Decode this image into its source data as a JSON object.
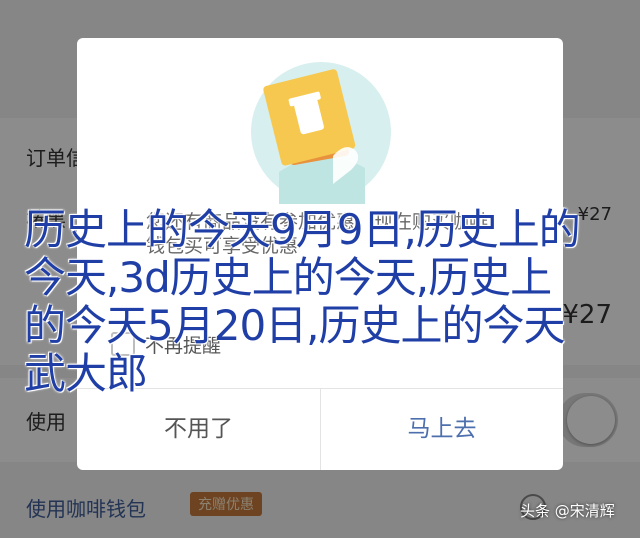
{
  "background": {
    "section_title": "订单信",
    "row1_label": "椿黑",
    "row1_price": "¥27",
    "big_price": "¥27",
    "row2_label": "使用",
    "coffee_wallet_label": "使用咖啡钱包",
    "promo_badge": "充赠优惠"
  },
  "dialog": {
    "message": "您还有商品没有参加优惠，现在购买咖啡钱包买可享受优惠",
    "checkbox_label": "不再提醒",
    "cancel_label": "不用了",
    "confirm_label": "马上去"
  },
  "headline": "历史上的今天9月9日,历史上的今天,3d历史上的今天,历史上的今天5月20日,历史上的今天武大郎",
  "watermark": "头条 @宋清辉",
  "colors": {
    "overlay": "#000000",
    "link_blue": "#4d6fae",
    "headline_blue": "#1f3ea6",
    "badge_orange": "#c77a3d"
  },
  "icons": {
    "illustration": "coffee-voucher-illustration",
    "checkbox": "checkbox-unchecked-icon"
  }
}
